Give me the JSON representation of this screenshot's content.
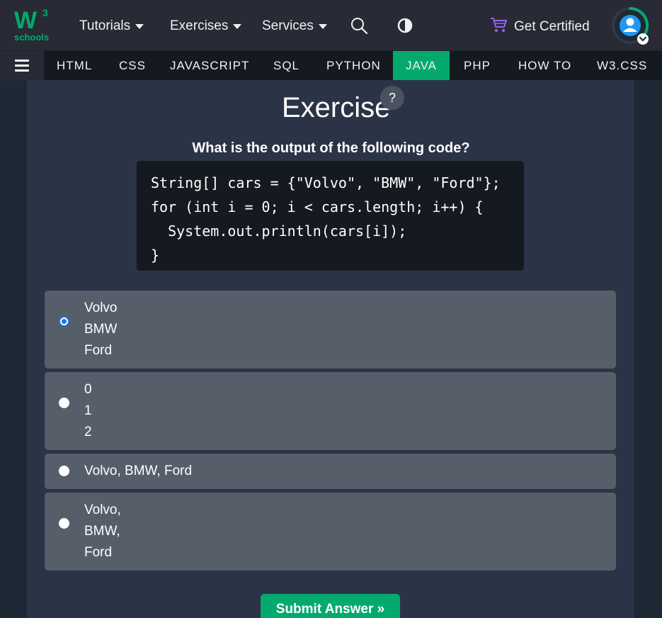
{
  "topbar": {
    "logo": {
      "mark": "W",
      "superscript": "3",
      "wordmark": "schools"
    },
    "nav": [
      {
        "label": "Tutorials"
      },
      {
        "label": "Exercises"
      },
      {
        "label": "Services"
      }
    ],
    "cta_label": "Get Certified",
    "icons": [
      "search-icon",
      "contrast-icon",
      "cart-icon",
      "avatar-icon"
    ]
  },
  "subnav": {
    "items": [
      "HTML",
      "CSS",
      "JAVASCRIPT",
      "SQL",
      "PYTHON",
      "JAVA",
      "PHP",
      "HOW TO",
      "W3.CSS"
    ],
    "active": "JAVA"
  },
  "exercise": {
    "title": "Exercise",
    "help_label": "?",
    "question": "What is the output of the following code?",
    "code": "String[] cars = {\"Volvo\", \"BMW\", \"Ford\"};\nfor (int i = 0; i < cars.length; i++) {\n  System.out.println(cars[i]);\n}",
    "options": [
      {
        "lines": [
          "Volvo",
          "BMW",
          "Ford"
        ],
        "selected": true
      },
      {
        "lines": [
          "0",
          "1",
          "2"
        ],
        "selected": false
      },
      {
        "lines": [
          "Volvo, BMW, Ford"
        ],
        "selected": false
      },
      {
        "lines": [
          "Volvo,",
          "BMW,",
          "Ford"
        ],
        "selected": false
      }
    ],
    "submit_label": "Submit Answer »"
  },
  "colors": {
    "brand_green": "#04aa6d",
    "cart_purple": "#9763f6",
    "radio_blue": "#1a73e8"
  }
}
